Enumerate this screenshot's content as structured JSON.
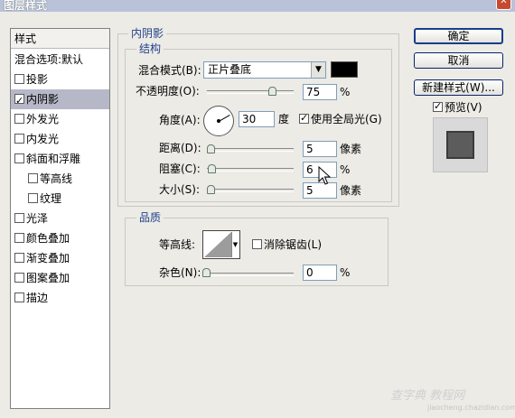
{
  "window": {
    "title": "图层样式"
  },
  "left_panel": {
    "header": "样式",
    "blend_options": "混合选项:默认",
    "items": [
      {
        "label": "投影",
        "checked": false
      },
      {
        "label": "内阴影",
        "checked": true
      },
      {
        "label": "外发光",
        "checked": false
      },
      {
        "label": "内发光",
        "checked": false
      },
      {
        "label": "斜面和浮雕",
        "checked": false
      },
      {
        "label": "等高线",
        "checked": false
      },
      {
        "label": "纹理",
        "checked": false
      },
      {
        "label": "光泽",
        "checked": false
      },
      {
        "label": "颜色叠加",
        "checked": false
      },
      {
        "label": "渐变叠加",
        "checked": false
      },
      {
        "label": "图案叠加",
        "checked": false
      },
      {
        "label": "描边",
        "checked": false
      }
    ]
  },
  "inner_shadow": {
    "group_title": "内阴影",
    "structure_title": "结构",
    "blend_mode_label": "混合模式(B):",
    "blend_mode_value": "正片叠底",
    "shadow_color": "#000000",
    "opacity_label": "不透明度(O):",
    "opacity_value": "75",
    "opacity_unit": "%",
    "angle_label": "角度(A):",
    "angle_value": "30",
    "angle_unit": "度",
    "global_light_label": "使用全局光(G)",
    "global_light_checked": true,
    "distance_label": "距离(D):",
    "distance_value": "5",
    "distance_unit": "像素",
    "choke_label": "阻塞(C):",
    "choke_value": "6",
    "choke_unit": "%",
    "size_label": "大小(S):",
    "size_value": "5",
    "size_unit": "像素"
  },
  "quality": {
    "title": "品质",
    "contour_label": "等高线:",
    "antialias_label": "消除锯齿(L)",
    "antialias_checked": false,
    "noise_label": "杂色(N):",
    "noise_value": "0",
    "noise_unit": "%"
  },
  "buttons": {
    "ok": "确定",
    "cancel": "取消",
    "new_style": "新建样式(W)...",
    "preview_label": "预览(V)",
    "preview_checked": true
  },
  "watermark": {
    "main": "查字典 教程网",
    "sub": "jiaocheng.chazidian.com"
  }
}
